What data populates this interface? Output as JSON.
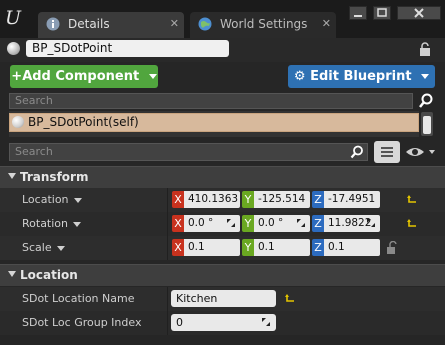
{
  "tabs": [
    {
      "label": "Details",
      "icon": "info-icon",
      "active": true
    },
    {
      "label": "World Settings",
      "icon": "globe-icon",
      "active": false
    }
  ],
  "object": {
    "name": "BP_SDotPoint"
  },
  "toolbar": {
    "add_component": "Add Component",
    "edit_blueprint": "Edit Blueprint"
  },
  "component_search": {
    "placeholder": "Search"
  },
  "components": [
    {
      "label": "BP_SDotPoint(self)"
    }
  ],
  "details_search": {
    "placeholder": "Search"
  },
  "categories": {
    "transform": "Transform",
    "location": "Location"
  },
  "transform": {
    "location": {
      "label": "Location",
      "x": "410.1363",
      "y": "-125.514",
      "z": "-17.4951"
    },
    "rotation": {
      "label": "Rotation",
      "x": "0.0 °",
      "y": "0.0 °",
      "z": "11.9822"
    },
    "scale": {
      "label": "Scale",
      "x": "0.1",
      "y": "0.1",
      "z": "0.1"
    }
  },
  "axis_tags": {
    "x": "X",
    "y": "Y",
    "z": "Z"
  },
  "location_props": {
    "name": {
      "label": "SDot Location Name",
      "value": "Kitchen"
    },
    "group_index": {
      "label": "SDot Loc Group Index",
      "value": "0"
    }
  },
  "colors": {
    "add_component_green": "#51a63e",
    "edit_blueprint_blue": "#2e71b3",
    "axis_x": "#c8321e",
    "axis_y": "#6aa821",
    "axis_z": "#2c6bbf",
    "selection": "#d7b99c"
  }
}
